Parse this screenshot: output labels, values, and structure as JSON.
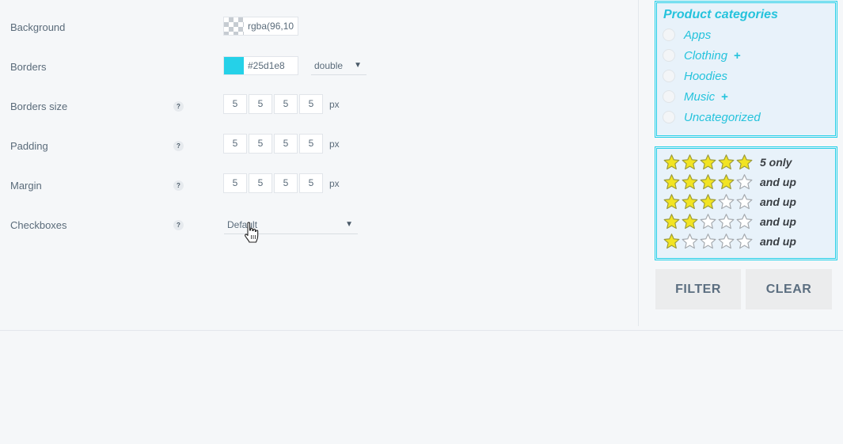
{
  "settings": {
    "background": {
      "label": "Background",
      "value": "rgba(96,10"
    },
    "borders": {
      "label": "Borders",
      "value": "#25d1e8",
      "style": "double",
      "color": "#25d1e8"
    },
    "borders_size": {
      "label": "Borders size",
      "help": "?",
      "values": [
        "5",
        "5",
        "5",
        "5"
      ],
      "unit": "px"
    },
    "padding": {
      "label": "Padding",
      "help": "?",
      "values": [
        "5",
        "5",
        "5",
        "5"
      ],
      "unit": "px"
    },
    "margin": {
      "label": "Margin",
      "help": "?",
      "values": [
        "5",
        "5",
        "5",
        "5"
      ],
      "unit": "px"
    },
    "checkboxes": {
      "label": "Checkboxes",
      "help": "?",
      "value": "Default"
    }
  },
  "categories": {
    "title": "Product categories",
    "items": [
      {
        "label": "Apps",
        "expandable": false
      },
      {
        "label": "Clothing",
        "expandable": true,
        "plus": "+"
      },
      {
        "label": "Hoodies",
        "expandable": false
      },
      {
        "label": "Music",
        "expandable": true,
        "plus": "+"
      },
      {
        "label": "Uncategorized",
        "expandable": false
      }
    ]
  },
  "rating": {
    "rows": [
      {
        "stars": 5,
        "label": "5 only"
      },
      {
        "stars": 4,
        "label": "and up"
      },
      {
        "stars": 3,
        "label": "and up"
      },
      {
        "stars": 2,
        "label": "and up"
      },
      {
        "stars": 1,
        "label": "and up"
      }
    ]
  },
  "buttons": {
    "filter": "FILTER",
    "clear": "CLEAR"
  },
  "colors": {
    "accent": "#25d1e8",
    "star_filled": "#f2e422",
    "panel_bg": "#e8f2fa",
    "button_bg": "#ebeced"
  }
}
